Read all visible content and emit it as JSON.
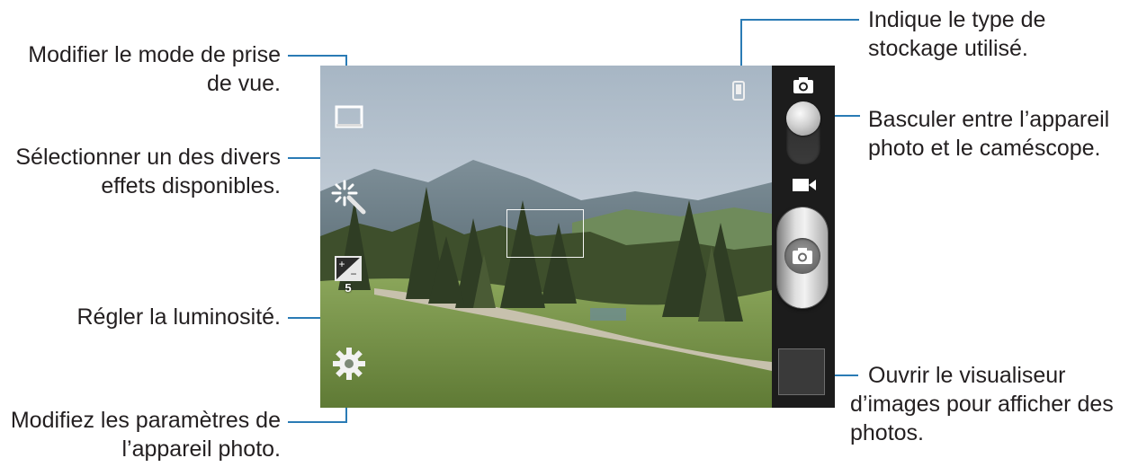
{
  "annotations": {
    "shooting_mode_line1": "Modifier le mode de prise",
    "shooting_mode_line2": "de vue.",
    "effects_line1": "Sélectionner un des divers",
    "effects_line2": "effets disponibles.",
    "brightness": "Régler la luminosité.",
    "settings_line1": "Modifiez les paramètres de",
    "settings_line2": "l’appareil photo.",
    "storage_line1": "Indique le type de",
    "storage_line2": "stockage utilisé.",
    "switch_line1": "Basculer entre l’appareil",
    "switch_line2": "photo et le caméscope.",
    "viewer_line1": "Ouvrir le visualiseur",
    "viewer_line2": "d’images pour afficher des",
    "viewer_line3": "photos."
  },
  "viewfinder": {
    "exposure_value": "5"
  },
  "icons": {
    "shooting_mode": "rectangle-mode-icon",
    "effects": "magic-wand-icon",
    "exposure": "exposure-plus-minus-icon",
    "settings": "gear-icon",
    "storage": "phone-storage-icon",
    "camera_mode": "camera-icon",
    "video_mode": "video-camera-icon",
    "shutter": "camera-shutter-icon"
  },
  "colors": {
    "callout_line": "#2a7bb5",
    "panel_bg": "#1c1c1c"
  }
}
